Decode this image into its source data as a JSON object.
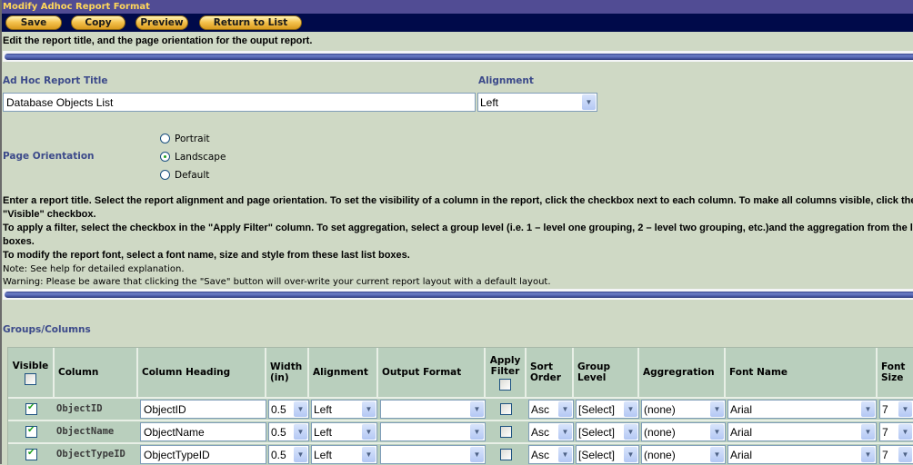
{
  "window": {
    "title": "Modify Adhoc Report Format"
  },
  "toolbar": {
    "save": "Save",
    "copy": "Copy",
    "preview": "Preview",
    "return": "Return to List"
  },
  "intro": "Edit the report title, and the page orientation for the ouput report.",
  "form": {
    "title_label": "Ad Hoc Report Title",
    "title_value": "Database Objects List",
    "alignment_label": "Alignment",
    "alignment_value": "Left",
    "orientation_label": "Page Orientation",
    "orientation_options": [
      "Portrait",
      "Landscape",
      "Default"
    ],
    "orientation_selected": "Landscape"
  },
  "help": {
    "line1": "Enter a report title. Select the report alignment and page orientation. To set the visibility of a column in the report, click the checkbox next to each column. To make all columns visible, click the",
    "line2": "\"Visible\" checkbox.",
    "line3": "To apply a filter, select the checkbox in the \"Apply Filter\" column. To set aggregation, select a group level (i.e. 1 – level one grouping, 2 – level two grouping, etc.)and the aggregation from the list",
    "line4": "boxes.",
    "line5": "To modify the report font, select a font name, size and style from these last list boxes.",
    "note": "Note: See help for detailed explanation.",
    "warning": "Warning: Please be aware that clicking the \"Save\" button will over-write your current report layout with a default layout."
  },
  "groups": {
    "label": "Groups/Columns",
    "headers": {
      "visible": "Visible",
      "column": "Column",
      "heading": "Column Heading",
      "width1": "Width",
      "width2": "(in)",
      "alignment": "Alignment",
      "output": "Output Format",
      "filter1": "Apply",
      "filter2": "Filter",
      "sort1": "Sort",
      "sort2": "Order",
      "group1": "Group",
      "group2": "Level",
      "aggregation": "Aggregration",
      "font": "Font Name",
      "size1": "Font",
      "size2": "Size"
    },
    "rows": [
      {
        "visible": true,
        "column": "ObjectID",
        "heading": "ObjectID",
        "width": "0.5",
        "alignment": "Left",
        "output": "",
        "filter": false,
        "sort": "Asc",
        "group": "[Select]",
        "aggregation": "(none)",
        "font": "Arial",
        "size": "7"
      },
      {
        "visible": true,
        "column": "ObjectName",
        "heading": "ObjectName",
        "width": "0.5",
        "alignment": "Left",
        "output": "",
        "filter": false,
        "sort": "Asc",
        "group": "[Select]",
        "aggregation": "(none)",
        "font": "Arial",
        "size": "7"
      },
      {
        "visible": true,
        "column": "ObjectTypeID",
        "heading": "ObjectTypeID",
        "width": "0.5",
        "alignment": "Left",
        "output": "",
        "filter": false,
        "sort": "Asc",
        "group": "[Select]",
        "aggregation": "(none)",
        "font": "Arial",
        "size": "7"
      }
    ]
  }
}
